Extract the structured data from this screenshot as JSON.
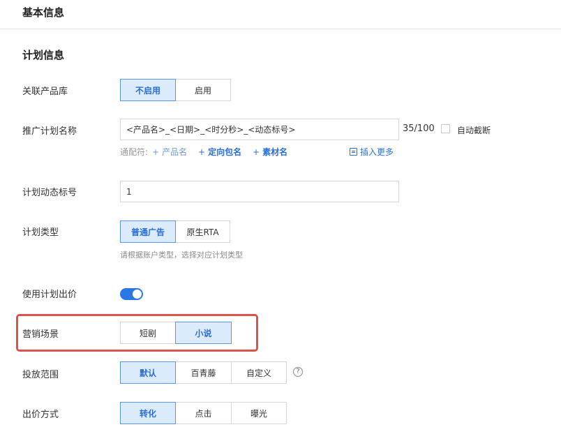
{
  "header": {
    "title": "基本信息"
  },
  "section": {
    "title": "计划信息"
  },
  "product_library": {
    "label": "关联产品库",
    "options": [
      "不启用",
      "启用"
    ],
    "selected": "不启用"
  },
  "plan_name": {
    "label": "推广计划名称",
    "value": "<产品名>_<日期>_<时分秒>_<动态标号>",
    "counter": "35/100",
    "auto_truncate_label": "自动截断",
    "wildcard_prefix": "通配符:",
    "wildcards": [
      "产品名",
      "定向包名",
      "素材名"
    ],
    "insert_more": "插入更多"
  },
  "dynamic_number": {
    "label": "计划动态标号",
    "value": "1"
  },
  "plan_type": {
    "label": "计划类型",
    "options": [
      "普通广告",
      "原生RTA"
    ],
    "selected": "普通广告",
    "hint": "请根据账户类型，选择对应计划类型"
  },
  "use_plan_bid": {
    "label": "使用计划出价",
    "enabled": true
  },
  "marketing_scene": {
    "label": "营销场景",
    "options": [
      "短剧",
      "小说"
    ],
    "selected": "小说"
  },
  "placement_scope": {
    "label": "投放范围",
    "options": [
      "默认",
      "百青藤",
      "自定义"
    ],
    "selected": "默认",
    "help": "?"
  },
  "bid_method": {
    "label": "出价方式",
    "options": [
      "转化",
      "点击",
      "曝光"
    ],
    "selected": "转化"
  },
  "colors": {
    "accent": "#2a6fd6",
    "active_bg": "#dcebfb",
    "highlight_border": "#d9534f",
    "toggle_on": "#2a78e4"
  }
}
